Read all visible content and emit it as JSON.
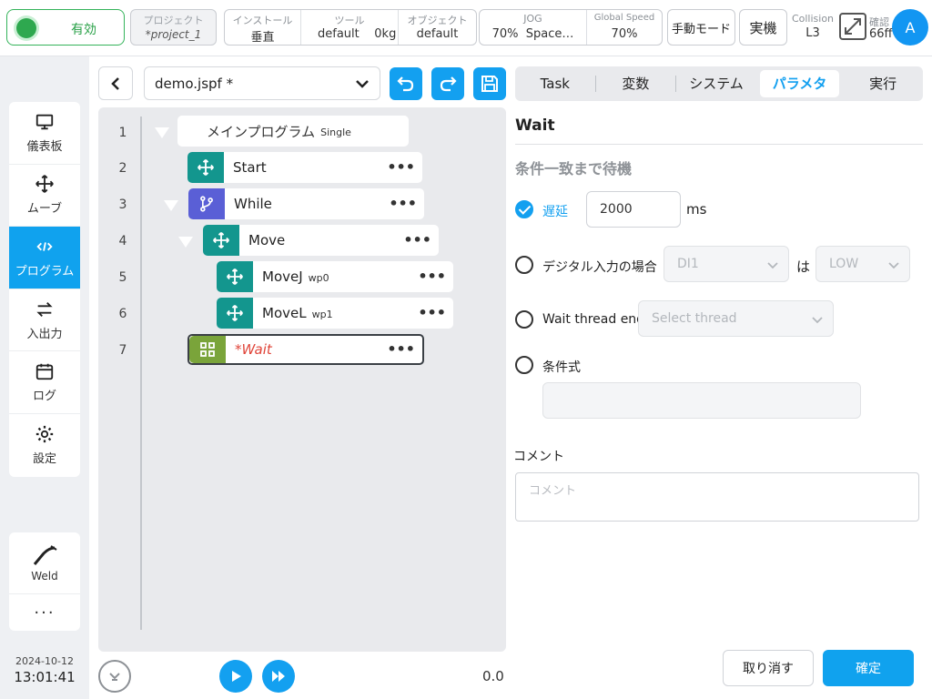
{
  "topbar": {
    "status": "有効",
    "project": {
      "label": "プロジェクト",
      "value": "*project_1"
    },
    "install": {
      "label": "インストール",
      "value": "垂直"
    },
    "tool": {
      "label": "ツール",
      "value": "default",
      "weight": "0kg"
    },
    "object": {
      "label": "オブジェクト",
      "value": "default"
    },
    "jog": {
      "label": "JOG",
      "value": "70%",
      "space": "Space…"
    },
    "global_speed": {
      "label": "Global Speed",
      "value": "70%"
    },
    "mode_button": "手動モード",
    "real_button": "実機",
    "collision": {
      "label": "Collision",
      "value": "L3"
    },
    "confirm": {
      "label": "確認",
      "value": "66ff"
    },
    "avatar": "A"
  },
  "sidebar": {
    "items": [
      {
        "label": "儀表板",
        "icon": "monitor-icon"
      },
      {
        "label": "ムーブ",
        "icon": "move-icon"
      },
      {
        "label": "プログラム",
        "icon": "code-icon"
      },
      {
        "label": "入出力",
        "icon": "swap-icon"
      },
      {
        "label": "ログ",
        "icon": "calendar-icon"
      },
      {
        "label": "設定",
        "icon": "gear-icon"
      }
    ],
    "weld": "Weld",
    "more": "···"
  },
  "clock": {
    "date": "2024-10-12",
    "time": "13:01:41"
  },
  "editor": {
    "file": "demo.jspf *",
    "tree": {
      "root": {
        "line": "1",
        "name": "メインプログラム",
        "sub": "Single"
      },
      "nodes": [
        {
          "line": "2",
          "name": "Start",
          "sub": ""
        },
        {
          "line": "3",
          "name": "While",
          "sub": ""
        },
        {
          "line": "4",
          "name": "Move",
          "sub": ""
        },
        {
          "line": "5",
          "name": "MoveJ",
          "sub": "wp0"
        },
        {
          "line": "6",
          "name": "MoveL",
          "sub": "wp1"
        },
        {
          "line": "7",
          "name": "*Wait",
          "sub": ""
        }
      ],
      "dots": "•••"
    },
    "speed": "0.0"
  },
  "tabs": [
    "Task",
    "変数",
    "システム",
    "パラメタ",
    "実行"
  ],
  "panel": {
    "title": "Wait",
    "section": "条件一致まで待機",
    "delay": {
      "label": "遅延",
      "value": "2000",
      "unit": "ms"
    },
    "digital": {
      "label": "デジタル入力の場合",
      "input": "DI1",
      "is": "は",
      "level": "LOW"
    },
    "thread": {
      "label": "Wait thread end",
      "placeholder": "Select thread"
    },
    "expr": {
      "label": "条件式"
    },
    "comment": {
      "label": "コメント",
      "placeholder": "コメント"
    },
    "cancel": "取り消す",
    "ok": "確定"
  }
}
